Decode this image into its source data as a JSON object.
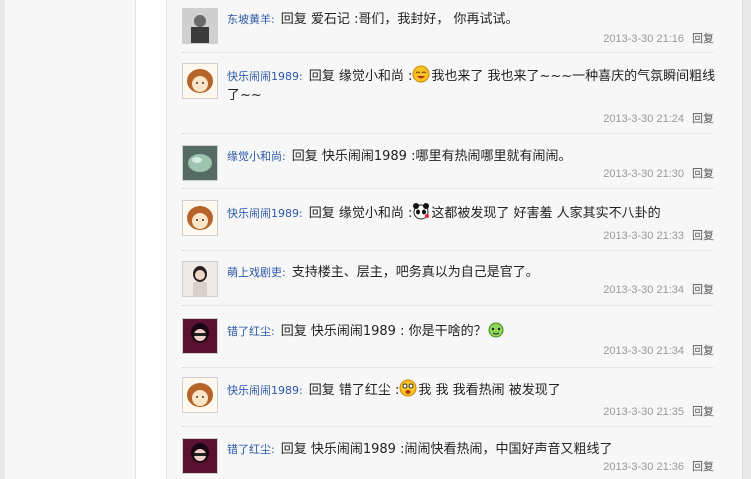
{
  "comments": [
    {
      "user": "东坡黄羊",
      "text": "回复 爱石记 :哥们，我封好， 你再试试。",
      "emoji": "",
      "time": "2013-3-30  21:16",
      "reply": "回复"
    },
    {
      "user": "快乐闹闹1989",
      "text": "回复 缘觉小和尚 :",
      "emoji": "laugh-emoji",
      "text2": "我也来了 我也来了~~~一种喜庆的气氛瞬间粗线了~~",
      "time": "2013-3-30  21:24",
      "reply": "回复"
    },
    {
      "user": "缘觉小和尚",
      "text": "回复 快乐闹闹1989 :哪里有热闹哪里就有闹闹。",
      "emoji": "",
      "time": "2013-3-30  21:30",
      "reply": "回复"
    },
    {
      "user": "快乐闹闹1989",
      "text": "回复 缘觉小和尚 :",
      "emoji": "panda-emoji",
      "text2": "这都被发现了 好害羞 人家其实不八卦的",
      "time": "2013-3-30  21:33",
      "reply": "回复"
    },
    {
      "user": "萌上戏剧吏",
      "text": "支持楼主、层主，吧务真以为自己是官了。",
      "emoji": "",
      "time": "2013-3-30  21:34",
      "reply": "回复"
    },
    {
      "user": "错了红尘",
      "text": "回复 快乐闹闹1989 : 你是干啥的？",
      "emoji": "green-emoji",
      "time": "2013-3-30  21:34",
      "reply": "回复"
    },
    {
      "user": "快乐闹闹1989",
      "text": "回复 错了红尘 :",
      "emoji": "shock-emoji",
      "text2": "我 我 我看热闹 被发现了",
      "time": "2013-3-30  21:35",
      "reply": "回复"
    },
    {
      "user": "错了红尘",
      "text": "回复 快乐闹闹1989 :闹闹快看热闹，中国好声音又粗线了",
      "emoji": "",
      "time": "2013-3-30  21:36",
      "reply": "回复"
    }
  ]
}
